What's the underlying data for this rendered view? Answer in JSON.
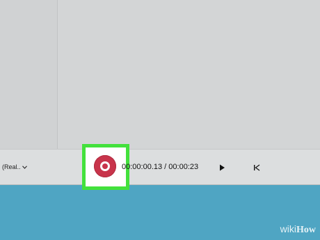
{
  "toolbar": {
    "quality_label": "(Real..",
    "timecode": "00:00:00.13 / 00:00:23",
    "icons": {
      "quality_dropdown": "chevron-down-icon",
      "record": "record-icon",
      "play": "play-icon",
      "skip_start": "skip-to-start-icon"
    }
  },
  "colors": {
    "highlight": "#43e13c",
    "record": "#c8344b",
    "desktop": "#4fa5c3"
  },
  "watermark": {
    "wiki": "wiki",
    "how": "How"
  }
}
